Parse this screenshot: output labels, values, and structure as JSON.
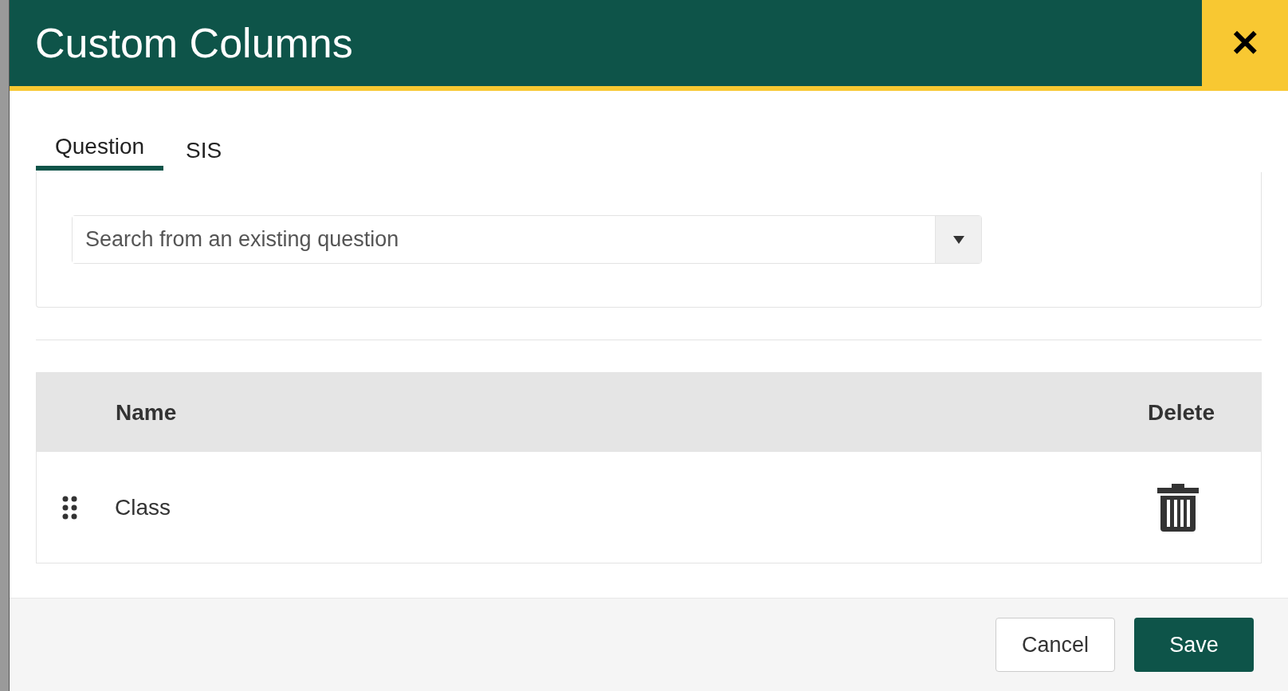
{
  "dialog": {
    "title": "Custom Columns",
    "close_glyph": "✕"
  },
  "tabs": [
    {
      "label": "Question",
      "selected": true
    },
    {
      "label": "SIS",
      "selected": false
    }
  ],
  "search": {
    "placeholder": "Search from an existing question"
  },
  "table": {
    "columns": [
      "Name",
      "Delete"
    ],
    "rows": [
      {
        "name": "Class"
      }
    ]
  },
  "buttons": [
    {
      "label": "Cancel",
      "kind": "secondary"
    },
    {
      "label": "Save",
      "kind": "primary"
    }
  ]
}
